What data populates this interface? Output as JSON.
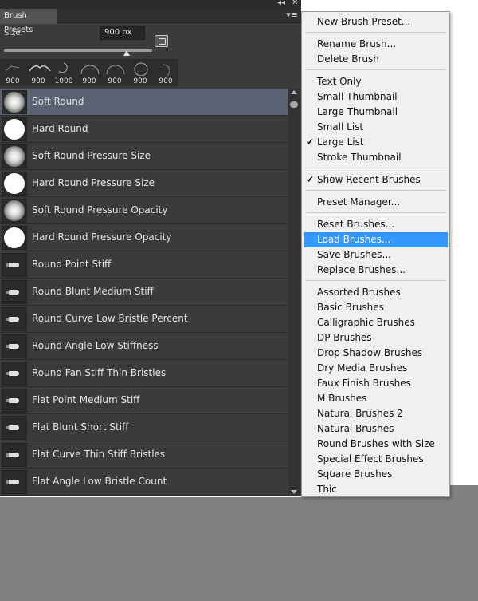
{
  "panel": {
    "tab_title": "Brush Presets",
    "collapse_glyph": "◂◂",
    "close_glyph": "✕",
    "menu_glyph": "▾≡",
    "size_label": "Size:",
    "size_value": "900 px",
    "size_slider_level": 0.84
  },
  "recent_brushes": [
    "900",
    "900",
    "1000",
    "900",
    "900",
    "900",
    "900"
  ],
  "brushes": [
    {
      "name": "Soft Round",
      "thumb": "soft",
      "selected": true
    },
    {
      "name": "Hard Round",
      "thumb": "hard"
    },
    {
      "name": "Soft Round Pressure Size",
      "thumb": "soft"
    },
    {
      "name": "Hard Round Pressure Size",
      "thumb": "hard"
    },
    {
      "name": "Soft Round Pressure Opacity",
      "thumb": "soft"
    },
    {
      "name": "Hard Round Pressure Opacity",
      "thumb": "hard"
    },
    {
      "name": "Round Point Stiff",
      "thumb": "stroke"
    },
    {
      "name": "Round Blunt Medium Stiff",
      "thumb": "stroke"
    },
    {
      "name": "Round Curve Low Bristle Percent",
      "thumb": "stroke"
    },
    {
      "name": "Round Angle Low Stiffness",
      "thumb": "stroke"
    },
    {
      "name": "Round Fan Stiff Thin Bristles",
      "thumb": "stroke"
    },
    {
      "name": "Flat Point Medium Stiff",
      "thumb": "stroke"
    },
    {
      "name": "Flat Blunt Short Stiff",
      "thumb": "stroke"
    },
    {
      "name": "Flat Curve Thin Stiff Bristles",
      "thumb": "stroke"
    },
    {
      "name": "Flat Angle Low Bristle Count",
      "thumb": "stroke"
    }
  ],
  "menu": {
    "check_glyph": "✔",
    "items": {
      "new_brush_preset": "New Brush Preset...",
      "rename_brush": "Rename Brush...",
      "delete_brush": "Delete Brush",
      "text_only": "Text Only",
      "small_thumbnail": "Small Thumbnail",
      "large_thumbnail": "Large Thumbnail",
      "small_list": "Small List",
      "large_list": "Large List",
      "stroke_thumbnail": "Stroke Thumbnail",
      "show_recent_brushes": "Show Recent Brushes",
      "preset_manager": "Preset Manager...",
      "reset_brushes": "Reset Brushes...",
      "load_brushes": "Load Brushes...",
      "save_brushes": "Save Brushes...",
      "replace_brushes": "Replace Brushes...",
      "assorted_brushes": "Assorted Brushes",
      "basic_brushes": "Basic Brushes",
      "calligraphic_brushes": "Calligraphic Brushes",
      "dp_brushes": "DP Brushes",
      "drop_shadow_brushes": "Drop Shadow Brushes",
      "dry_media_brushes": "Dry Media Brushes",
      "faux_finish_brushes": "Faux Finish Brushes",
      "m_brushes": "M Brushes",
      "natural_brushes_2": "Natural Brushes 2",
      "natural_brushes": "Natural Brushes",
      "round_brushes_with_size": "Round Brushes with Size",
      "special_effect_brushes": "Special Effect Brushes",
      "square_brushes": "Square Brushes",
      "thick": "Thic"
    },
    "highlight_color": "#3399ff"
  }
}
